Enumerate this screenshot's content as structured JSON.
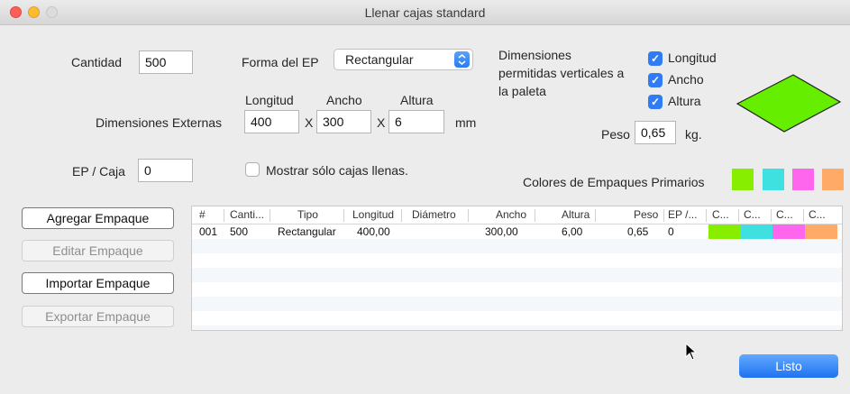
{
  "window": {
    "title": "Llenar cajas standard"
  },
  "form": {
    "cantidad_label": "Cantidad",
    "cantidad_value": "500",
    "forma_label": "Forma del EP",
    "forma_value": "Rectangular",
    "dim_ext_label": "Dimensiones Externas",
    "col_longitud": "Longitud",
    "col_ancho": "Ancho",
    "col_altura": "Altura",
    "longitud_value": "400",
    "ancho_value": "300",
    "altura_value": "6",
    "x1": "X",
    "x2": "X",
    "unit_mm": "mm",
    "ep_caja_label": "EP / Caja",
    "ep_caja_value": "0",
    "mostrar_label": "Mostrar sólo cajas llenas.",
    "dim_permitidas_line1": "Dimensiones",
    "dim_permitidas_line2": "permitidas verticales a",
    "dim_permitidas_line3": "la paleta",
    "chk_longitud": "Longitud",
    "chk_ancho": "Ancho",
    "chk_altura": "Altura",
    "peso_label": "Peso",
    "peso_value": "0,65",
    "peso_unit": "kg.",
    "colores_label": "Colores de Empaques Primarios",
    "colors": [
      "#88ee00",
      "#3ee0e0",
      "#ff66ee",
      "#ffaa66"
    ],
    "box_color": "#66ee00"
  },
  "buttons": {
    "agregar": "Agregar Empaque",
    "editar": "Editar Empaque",
    "importar": "Importar Empaque",
    "exportar": "Exportar Empaque",
    "listo": "Listo"
  },
  "table": {
    "headers": [
      "#",
      "Canti...",
      "Tipo",
      "Longitud",
      "Diámetro",
      "Ancho",
      "Altura",
      "Peso",
      "EP /...",
      "C...",
      "C...",
      "C...",
      "C..."
    ],
    "rows": [
      {
        "num": "001",
        "cantidad": "500",
        "tipo": "Rectangular",
        "longitud": "400,00",
        "diametro": "",
        "ancho": "300,00",
        "altura": "6,00",
        "peso": "0,65",
        "ep": "0"
      }
    ]
  }
}
